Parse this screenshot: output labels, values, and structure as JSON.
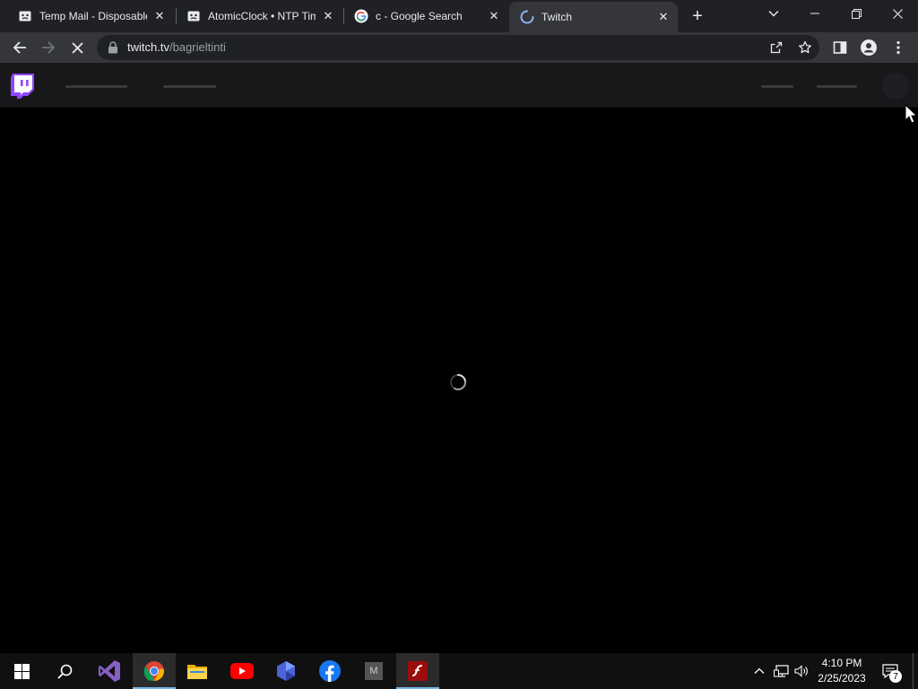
{
  "browser": {
    "tabs": [
      {
        "title": "Temp Mail - Disposable Temporary Email",
        "favicon": "temp-mail-icon",
        "active": false
      },
      {
        "title": "AtomicClock • NTP Time Server",
        "favicon": "atomicclock-icon",
        "active": false
      },
      {
        "title": "c - Google Search",
        "favicon": "google-icon",
        "active": false
      },
      {
        "title": "Twitch",
        "favicon": "loading-spinner-icon",
        "active": true
      }
    ],
    "new_tab_label": "+",
    "address": {
      "domain": "twitch.tv",
      "path": "/bagrieltinti"
    },
    "loading": true
  },
  "page": {
    "brand_color": "#9146ff",
    "state": "loading"
  },
  "taskbar": {
    "apps": [
      {
        "name": "start-button"
      },
      {
        "name": "search-button"
      },
      {
        "name": "visual-studio"
      },
      {
        "name": "chrome",
        "active": true
      },
      {
        "name": "file-explorer"
      },
      {
        "name": "youtube"
      },
      {
        "name": "app-hexagon"
      },
      {
        "name": "facebook"
      },
      {
        "name": "app-m",
        "label": "M"
      },
      {
        "name": "flash-player",
        "active": true
      }
    ],
    "clock": {
      "time": "4:10 PM",
      "date": "2/25/2023"
    },
    "notifications_count": "7"
  }
}
